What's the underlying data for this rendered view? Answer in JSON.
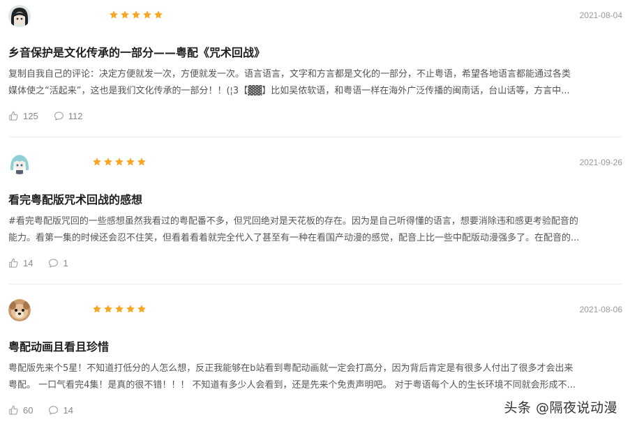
{
  "colors": {
    "star": "#f5a623",
    "date": "#999999",
    "meta": "#888888"
  },
  "reviews": [
    {
      "avatar": "avatar-girl-dark-hair",
      "rating": 5,
      "date": "2021-08-04",
      "title": "乡音保护是文化传承的一部分——粤配《咒术回战》",
      "body_line1": "复制自我自己的评论：决定方便就发一次，方便就发一次。语言语言，文字和方言都是文化的一部分，不止粤语，希望各地语言都能通过各类",
      "body_line2": "媒体使之“活起来”，这也是我们文化传承的一部分！！(¦3【▓▓】比如吴侬软语，和粤语一样在海外广泛传播的闽南话，台山话等，方言中...",
      "likes": "125",
      "comments": "112"
    },
    {
      "avatar": "avatar-teal-hair",
      "rating": 5,
      "date": "2021-09-26",
      "title": "看完粤配版咒术回战的感想",
      "body_line1": "#看完粤配版咒回的一些感想虽然我看过的粤配番不多，但咒回绝对是天花板的存在。因为是自己听得懂的语言，想要消除违和感更考验配音的",
      "body_line2": "能力。看第一集的时候还会忍不住笑，但看着看着就完全代入了甚至有一种在看国产动漫的感觉，配音上比一些中配版动漫强多了。在配音的...",
      "likes": "14",
      "comments": "1"
    },
    {
      "avatar": "avatar-dog",
      "rating": 5,
      "date": "2021-08-06",
      "title": "粤配动画且看且珍惜",
      "body_line1": "粤配版先来个5星！不知道打低分的人怎么想，反正我能够在b站看到粤配动画就一定会打高分，因为背后肯定是有很多人付出了很多才会出来",
      "body_line2": "粤配。 一口气看完4集！是真的很不错！！！ 不知道有多少人会看到，还是先来个免责声明吧。 对于粤语每个人的生长环境不同就会形成不...",
      "likes": "60",
      "comments": "14"
    }
  ],
  "watermark": "头条 @隔夜说动漫"
}
